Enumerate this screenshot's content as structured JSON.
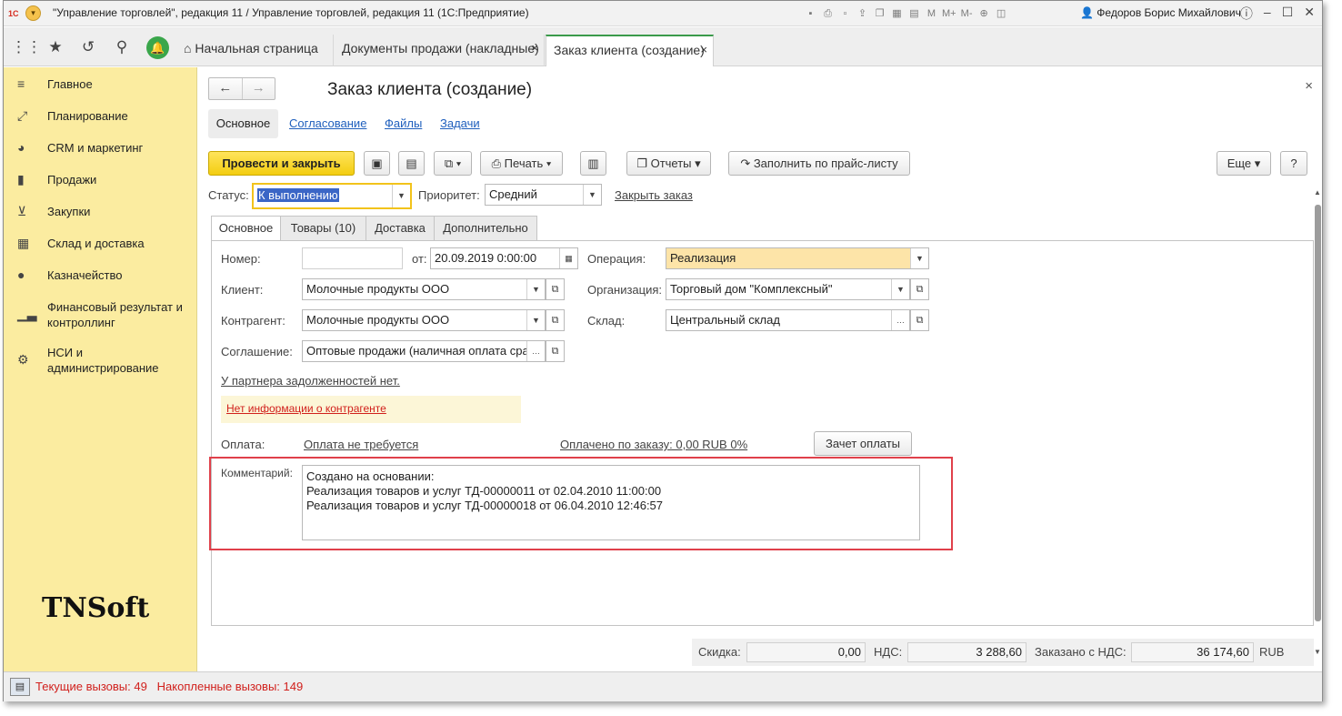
{
  "window": {
    "app_logo": "1С",
    "title": "\"Управление торговлей\", редакция 11 / Управление торговлей, редакция 11  (1С:Предприятие)",
    "user": "Федоров Борис Михайлович",
    "tb_m": "M",
    "tb_mplus": "M+",
    "tb_mminus": "M-"
  },
  "tabs": [
    {
      "label": "Начальная страница"
    },
    {
      "label": "Документы продажи (накладные)",
      "close": "×"
    },
    {
      "label": "Заказ клиента (создание)",
      "close": "×"
    }
  ],
  "sidebar": {
    "items": [
      {
        "label": "Главное",
        "icon": "menu-icon"
      },
      {
        "label": "Планирование",
        "icon": "planning-icon"
      },
      {
        "label": "CRM и маркетинг",
        "icon": "crm-icon"
      },
      {
        "label": "Продажи",
        "icon": "sales-bag-icon"
      },
      {
        "label": "Закупки",
        "icon": "cart-icon"
      },
      {
        "label": "Склад и доставка",
        "icon": "warehouse-icon"
      },
      {
        "label": "Казначейство",
        "icon": "ruble-icon"
      },
      {
        "label": "Финансовый результат и контроллинг",
        "icon": "chart-icon"
      },
      {
        "label": "НСИ и администрирование",
        "icon": "gear-icon"
      }
    ],
    "logo": "TNSoft"
  },
  "form": {
    "title": "Заказ клиента (создание)",
    "nav_tabs": [
      "Основное",
      "Согласование",
      "Файлы",
      "Задачи"
    ],
    "buttons": {
      "post_close": "Провести и закрыть",
      "print": "Печать",
      "reports": "Отчеты",
      "fill_pricelist": "Заполнить по прайс-листу",
      "more": "Еще",
      "help": "?"
    },
    "status_label": "Статус:",
    "status_value": "К выполнению",
    "priority_label": "Приоритет:",
    "priority_value": "Средний",
    "close_order": "Закрыть заказ",
    "inner_tabs": [
      "Основное",
      "Товары (10)",
      "Доставка",
      "Дополнительно"
    ],
    "number_label": "Номер:",
    "number_value": "",
    "date_label": "от:",
    "date_value": "20.09.2019  0:00:00",
    "operation_label": "Операция:",
    "operation_value": "Реализация",
    "client_label": "Клиент:",
    "client_value": "Молочные продукты ООО",
    "org_label": "Организация:",
    "org_value": "Торговый дом \"Комплексный\"",
    "contractor_label": "Контрагент:",
    "contractor_value": "Молочные продукты ООО",
    "warehouse_label": "Склад:",
    "warehouse_value": "Центральный склад",
    "agreement_label": "Соглашение:",
    "agreement_value": "Оптовые продажи (наличная оплата сра",
    "debt_link": "У партнера задолженностей нет.",
    "warning": "Нет информации о контрагенте",
    "payment_label": "Оплата:",
    "payment_link": "Оплата не требуется",
    "paid_link": "Оплачено по заказу: 0,00 RUB  0%",
    "offset_btn": "Зачет оплаты",
    "comment_label": "Комментарий:",
    "comment_lines": [
      "Создано на основании:",
      "Реализация товаров и услуг ТД-00000011 от 02.04.2010 11:00:00",
      "Реализация товаров и услуг ТД-00000018 от 06.04.2010 12:46:57"
    ],
    "discount_label": "Скидка:",
    "discount_value": "0,00",
    "vat_label": "НДС:",
    "vat_value": "3 288,60",
    "ordered_label": "Заказано с НДС:",
    "ordered_value": "36 174,60",
    "currency": "RUB"
  },
  "statusbar": {
    "current_calls": "Текущие вызовы: 49",
    "accumulated_calls": "Накопленные вызовы: 149"
  },
  "colors": {
    "sidebar_bg": "#fbeca0",
    "primary_button": "#f5d11a",
    "link": "#1f5fbd",
    "warning_text": "#d1201c",
    "highlight_box": "#e0404a",
    "active_tab_accent": "#3a9a4a"
  }
}
